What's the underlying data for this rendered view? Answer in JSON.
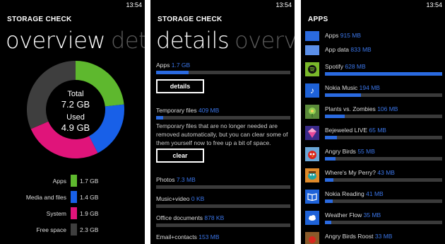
{
  "status": {
    "time": "13:54"
  },
  "overview": {
    "app_title": "STORAGE CHECK",
    "pivot_active": "overview",
    "pivot_next": "details",
    "total_label": "Total",
    "total_value": "7.2 GB",
    "used_label": "Used",
    "used_value": "4.9 GB",
    "legend": [
      {
        "label": "Apps",
        "value": "1.7 GB",
        "color": "#5eb82e"
      },
      {
        "label": "Media and files",
        "value": "1.4 GB",
        "color": "#1860e8"
      },
      {
        "label": "System",
        "value": "1.9 GB",
        "color": "#e0147a"
      },
      {
        "label": "Free space",
        "value": "2.3 GB",
        "color": "#3e3e3e"
      }
    ]
  },
  "chart_data": {
    "type": "pie",
    "categories": [
      "Apps",
      "Media and files",
      "System",
      "Free space"
    ],
    "values": [
      1.7,
      1.4,
      1.9,
      2.3
    ],
    "colors": [
      "#5eb82e",
      "#1860e8",
      "#e0147a",
      "#3e3e3e"
    ],
    "unit": "GB"
  },
  "details": {
    "app_title": "STORAGE CHECK",
    "pivot_active": "details",
    "pivot_next": "overview",
    "apps": {
      "label": "Apps",
      "size": "1.7 GB",
      "fraction": 0.24
    },
    "details_button": "details",
    "temp": {
      "label": "Temporary files",
      "size": "409 MB",
      "fraction": 0.05
    },
    "temp_desc": "Temporary files that are no longer needed are removed automatically, but you can clear some of them yourself now to free up a bit of space.",
    "clear_button": "clear",
    "photos": {
      "label": "Photos",
      "size": "7.3 MB",
      "fraction": 0.0
    },
    "music": {
      "label": "Music+video",
      "size": "0 KB",
      "fraction": 0.0
    },
    "office": {
      "label": "Office documents",
      "size": "878 KB",
      "fraction": 0.0
    },
    "email": {
      "label": "Email+contacts",
      "size": "153 MB"
    }
  },
  "apps_panel": {
    "title": "APPS",
    "items": [
      {
        "name": "Apps",
        "size": "915 MB",
        "icon": "apps-tile-icon"
      },
      {
        "name": "App data",
        "size": "833 MB",
        "icon": "app-data-tile-icon"
      },
      {
        "name": "Spotify",
        "size": "628 MB",
        "icon": "spotify-icon",
        "fraction": 1.0
      },
      {
        "name": "Nokia Music",
        "size": "194 MB",
        "icon": "music-note-icon",
        "fraction": 0.31
      },
      {
        "name": "Plants vs. Zombies",
        "size": "106 MB",
        "icon": "plants-vs-zombies-icon",
        "fraction": 0.17
      },
      {
        "name": "Bejeweled LIVE",
        "size": "65 MB",
        "icon": "bejeweled-icon",
        "fraction": 0.1
      },
      {
        "name": "Angry Birds",
        "size": "55 MB",
        "icon": "angry-birds-icon",
        "fraction": 0.09
      },
      {
        "name": "Where's My Perry?",
        "size": "43 MB",
        "icon": "wheres-my-perry-icon",
        "fraction": 0.07
      },
      {
        "name": "Nokia Reading",
        "size": "41 MB",
        "icon": "nokia-reading-icon",
        "fraction": 0.065
      },
      {
        "name": "Weather Flow",
        "size": "35 MB",
        "icon": "weather-flow-icon",
        "fraction": 0.055
      },
      {
        "name": "Angry Birds Roost",
        "size": "33 MB",
        "icon": "angry-birds-roost-icon"
      }
    ]
  }
}
